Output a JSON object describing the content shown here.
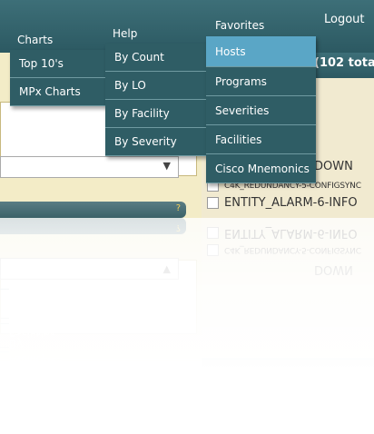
{
  "nav": {
    "charts": "Charts",
    "help": "Help",
    "favorites": "Favorites",
    "logout": "Logout"
  },
  "menus": {
    "charts": [
      "Top 10's",
      "MPx Charts"
    ],
    "help": [
      "By Count",
      "By LO",
      "By Facility",
      "By Severity"
    ],
    "favorites": [
      "Hosts",
      "Programs",
      "Severities",
      "Facilities",
      "Cisco Mnemonics"
    ],
    "favorites_selected": "Hosts"
  },
  "right_panel": {
    "header_text": "(102 tota",
    "rows": [
      "DOWN",
      "C4K_REDUNDANCY-5-CONFIGSYNC",
      "ENTITY_ALARM-6-INFO"
    ]
  },
  "left_panel": {
    "dropdown_arrow": "▼",
    "help_badge": "?"
  },
  "colors": {
    "nav_bg": "#2f5d65",
    "menu_selected": "#5aa6c6",
    "panel_bg": "#f3ecc7"
  }
}
